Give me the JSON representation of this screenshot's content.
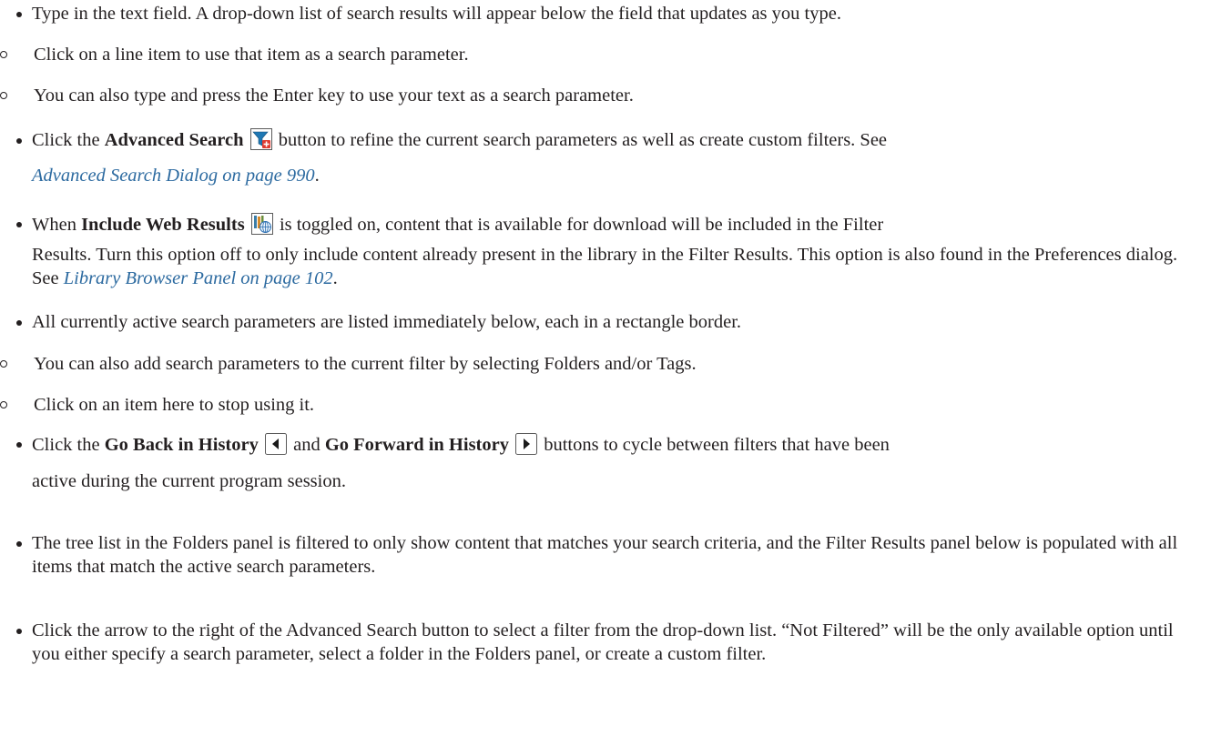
{
  "items": {
    "type_text": "Type in the text field. A drop-down list of search results will appear below the field that updates as you type.",
    "click_line_item": "Click on a line item to use that item as a search parameter.",
    "enter_key": "You can also type and press the Enter key to use your text as a search parameter.",
    "advanced": {
      "pre": "Click the ",
      "bold": "Advanced Search",
      "post": " button to refine the current search parameters as well as create custom filters. See ",
      "link": "Advanced Search Dialog on page 990",
      "end": "."
    },
    "web": {
      "pre": "When ",
      "bold": "Include Web Results",
      "post_line1": " is toggled on, content that is available for download will be included in the Filter",
      "line2": "Results. Turn this option off to only include content already present in the library in the Filter Results. This option is also found in the Preferences dialog. See ",
      "link": "Library Browser Panel on page 102",
      "end": "."
    },
    "active_params": "All currently active search parameters are listed immediately below, each in a rectangle border.",
    "folders_tags": "You can also add search parameters to the current filter by selecting Folders and/or Tags.",
    "stop_using": "Click on an item here to stop using it.",
    "history": {
      "pre": "Click the ",
      "bold_back": "Go Back in History",
      "mid": " and ",
      "bold_fwd": "Go Forward in History",
      "post": " buttons to cycle between filters that have been",
      "line2": "active during the current program session."
    },
    "tree_list": "The tree list in the Folders panel is filtered to only show content that matches your search criteria, and the Filter Results panel below is populated with all items that match the active search parameters.",
    "dropdown": "Click the arrow to the right of the Advanced Search button to select a filter from the drop-down list. “Not Filtered” will be the only available option until you either specify a search parameter, select a folder in the Folders panel, or create a custom filter."
  },
  "icons": {
    "advanced_search": "funnel-plus-icon",
    "include_web_results": "library-globe-icon",
    "go_back": "triangle-left-icon",
    "go_forward": "triangle-right-icon"
  },
  "colors": {
    "text": "#231f20",
    "link": "#2c6aa0",
    "icon_blue": "#1f78b4",
    "icon_red": "#e03a2f"
  }
}
